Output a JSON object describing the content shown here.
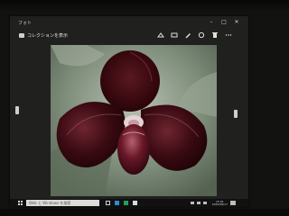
{
  "window": {
    "title": "フォト",
    "collection_label": "コレクションを表示"
  },
  "toolbar": {
    "icons": [
      "share-icon",
      "slideshow-icon",
      "edit-icon",
      "rotate-icon",
      "delete-icon",
      "more-icon"
    ]
  },
  "title_controls": {
    "minimize": "–",
    "maximize": "□",
    "close": "✕"
  },
  "photo": {
    "subject": "dark red slipper orchid",
    "colors": {
      "petal": "#3a0a10",
      "highlight": "#7a2a35",
      "background": "#8e9a8a"
    }
  },
  "taskbar": {
    "search_placeholder": "Web と Windows を検索",
    "clock_time": "15:01",
    "clock_date": "2015/08/17"
  }
}
